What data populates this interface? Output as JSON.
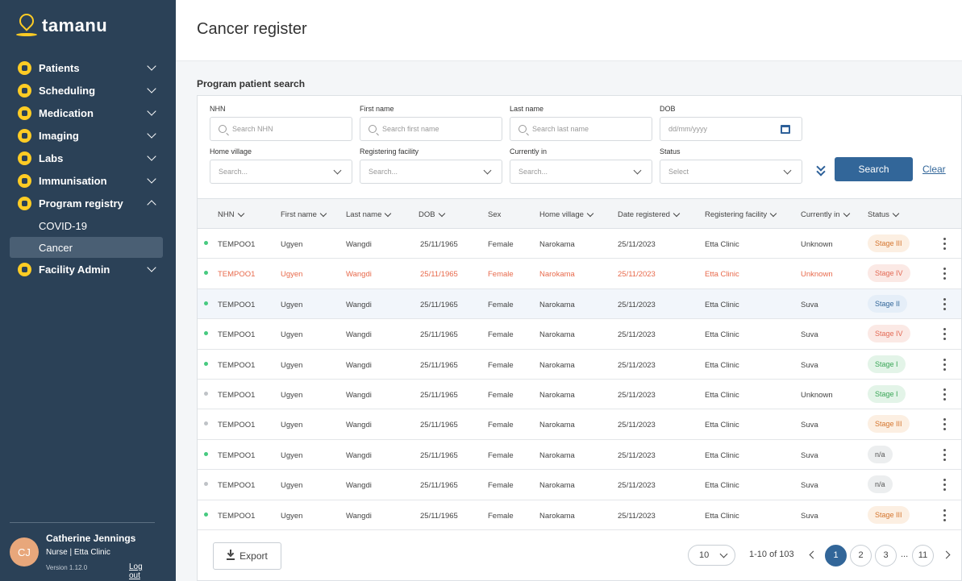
{
  "app": {
    "brand": "tamanu"
  },
  "sidebar": {
    "items": [
      {
        "label": "Patients",
        "icon": "patients-icon",
        "expanded": false
      },
      {
        "label": "Scheduling",
        "icon": "calendar-icon",
        "expanded": false
      },
      {
        "label": "Medication",
        "icon": "medication-icon",
        "expanded": false
      },
      {
        "label": "Imaging",
        "icon": "imaging-icon",
        "expanded": false
      },
      {
        "label": "Labs",
        "icon": "labs-icon",
        "expanded": false
      },
      {
        "label": "Immunisation",
        "icon": "immunisation-icon",
        "expanded": false
      },
      {
        "label": "Program registry",
        "icon": "program-registry-icon",
        "expanded": true
      }
    ],
    "sub_items": [
      {
        "label": "COVID-19",
        "active": false
      },
      {
        "label": "Cancer",
        "active": true
      }
    ],
    "facility_admin": {
      "label": "Facility Admin",
      "icon": "facility-admin-icon"
    },
    "user": {
      "initials": "CJ",
      "name": "Catherine Jennings",
      "role": "Nurse | Etta Clinic",
      "version": "Version 1.12.0",
      "logout": "Log out"
    }
  },
  "header": {
    "title": "Cancer register"
  },
  "search": {
    "title": "Program patient search",
    "fields": {
      "nhn": {
        "label": "NHN",
        "placeholder": "Search NHN"
      },
      "first_name": {
        "label": "First name",
        "placeholder": "Search first name"
      },
      "last_name": {
        "label": "Last name",
        "placeholder": "Search last name"
      },
      "dob": {
        "label": "DOB",
        "placeholder": "dd/mm/yyyy"
      },
      "home_village": {
        "label": "Home village",
        "placeholder": "Search..."
      },
      "registering_facility": {
        "label": "Registering facility",
        "placeholder": "Search..."
      },
      "currently_in": {
        "label": "Currently in",
        "placeholder": "Search..."
      },
      "status": {
        "label": "Status",
        "placeholder": "Select"
      }
    },
    "search_label": "Search",
    "clear_label": "Clear"
  },
  "table": {
    "columns": [
      "NHN",
      "First name",
      "Last name",
      "DOB",
      "Sex",
      "Home village",
      "Date registered",
      "Registering facility",
      "Currently in",
      "Status"
    ],
    "rows": [
      {
        "active": true,
        "nhn": "TEMPOO1",
        "first": "Ugyen",
        "last": "Wangdi",
        "dob": "25/11/1965",
        "sex": "Female",
        "village": "Narokama",
        "registered": "25/11/2023",
        "facility": "Etta Clinic",
        "currently": "Unknown",
        "status": "Stage III",
        "tone": "b3"
      },
      {
        "active": true,
        "nhn": "TEMPOO1",
        "first": "Ugyen",
        "last": "Wangdi",
        "dob": "25/11/1965",
        "sex": "Female",
        "village": "Narokama",
        "registered": "25/11/2023",
        "facility": "Etta Clinic",
        "currently": "Unknown",
        "status": "Stage IV",
        "tone": "b4",
        "red": true
      },
      {
        "active": true,
        "nhn": "TEMPOO1",
        "first": "Ugyen",
        "last": "Wangdi",
        "dob": "25/11/1965",
        "sex": "Female",
        "village": "Narokama",
        "registered": "25/11/2023",
        "facility": "Etta Clinic",
        "currently": "Suva",
        "status": "Stage II",
        "tone": "b2",
        "highlight": true
      },
      {
        "active": true,
        "nhn": "TEMPOO1",
        "first": "Ugyen",
        "last": "Wangdi",
        "dob": "25/11/1965",
        "sex": "Female",
        "village": "Narokama",
        "registered": "25/11/2023",
        "facility": "Etta Clinic",
        "currently": "Suva",
        "status": "Stage IV",
        "tone": "b4"
      },
      {
        "active": true,
        "nhn": "TEMPOO1",
        "first": "Ugyen",
        "last": "Wangdi",
        "dob": "25/11/1965",
        "sex": "Female",
        "village": "Narokama",
        "registered": "25/11/2023",
        "facility": "Etta Clinic",
        "currently": "Suva",
        "status": "Stage I",
        "tone": "b1"
      },
      {
        "active": false,
        "nhn": "TEMPOO1",
        "first": "Ugyen",
        "last": "Wangdi",
        "dob": "25/11/1965",
        "sex": "Female",
        "village": "Narokama",
        "registered": "25/11/2023",
        "facility": "Etta Clinic",
        "currently": "Unknown",
        "status": "Stage I",
        "tone": "b1"
      },
      {
        "active": false,
        "nhn": "TEMPOO1",
        "first": "Ugyen",
        "last": "Wangdi",
        "dob": "25/11/1965",
        "sex": "Female",
        "village": "Narokama",
        "registered": "25/11/2023",
        "facility": "Etta Clinic",
        "currently": "Suva",
        "status": "Stage III",
        "tone": "b3"
      },
      {
        "active": true,
        "nhn": "TEMPOO1",
        "first": "Ugyen",
        "last": "Wangdi",
        "dob": "25/11/1965",
        "sex": "Female",
        "village": "Narokama",
        "registered": "25/11/2023",
        "facility": "Etta Clinic",
        "currently": "Suva",
        "status": "n/a",
        "tone": "bna"
      },
      {
        "active": false,
        "nhn": "TEMPOO1",
        "first": "Ugyen",
        "last": "Wangdi",
        "dob": "25/11/1965",
        "sex": "Female",
        "village": "Narokama",
        "registered": "25/11/2023",
        "facility": "Etta Clinic",
        "currently": "Suva",
        "status": "n/a",
        "tone": "bna"
      },
      {
        "active": true,
        "nhn": "TEMPOO1",
        "first": "Ugyen",
        "last": "Wangdi",
        "dob": "25/11/1965",
        "sex": "Female",
        "village": "Narokama",
        "registered": "25/11/2023",
        "facility": "Etta Clinic",
        "currently": "Suva",
        "status": "Stage III",
        "tone": "b3"
      }
    ]
  },
  "pagination": {
    "export_label": "Export",
    "per_page": "10",
    "range": "1-10 of 103",
    "pages": [
      "1",
      "2",
      "3"
    ],
    "ellipsis": "...",
    "last_page": "11",
    "current": "1"
  },
  "colors": {
    "sidebar": "#2b4157",
    "accent": "#326699",
    "brand_yellow": "#ffcc24"
  }
}
